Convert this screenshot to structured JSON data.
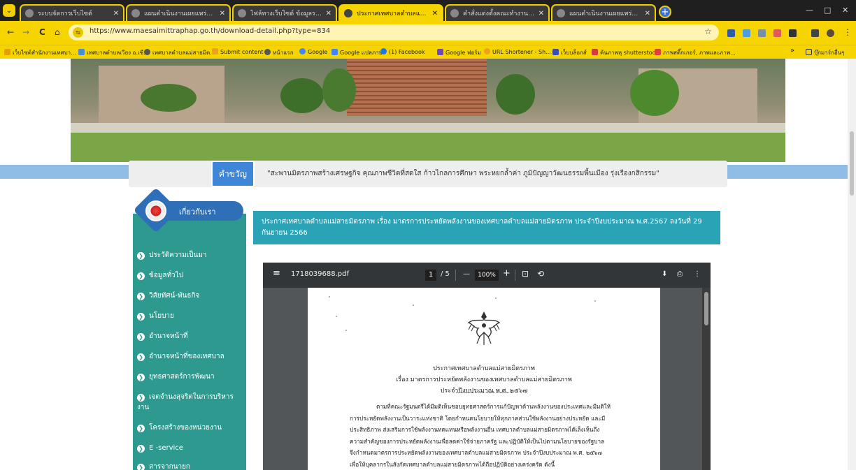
{
  "browser": {
    "tabs": [
      {
        "title": "ระบบจัดการเว็บไซต์",
        "active": false
      },
      {
        "title": "แผนดำเนินงานเผยแพร่ภาพข่าวภารกิจ",
        "active": false
      },
      {
        "title": "ไฟล์ทางเว็บไซต์ ข้อมูลรายเว็บไซต์",
        "active": false
      },
      {
        "title": "ประกาศเทศบาลตำบลแม่สายมิตรภาพ",
        "active": true
      },
      {
        "title": "คำสั่งแต่งตั้งคณะทำงานตามมาตรการ",
        "active": false
      },
      {
        "title": "แผนดำเนินงานเผยแพร่ภาพข่าวภารกิจ",
        "active": false
      }
    ],
    "new_tab_symbol": "+",
    "window_minimize": "—",
    "window_restore": "□",
    "window_close": "✕",
    "nav": {
      "back": "←",
      "forward": "→",
      "reload": "C",
      "home": "⌂"
    },
    "url": "https://www.maesaimittraphap.go.th/download-detail.php?type=834",
    "bookmark_star": "☆",
    "bookmarks": [
      "เว็บไซต์สำนักงานเทศบา...",
      "เทศบาลตำบลเวียง อ.เชี...",
      "เทศบาลตำบลแม่สายมิต...",
      "Submit content",
      "หน้าแรก",
      "Google",
      "Google แปลภาษา",
      "(1) Facebook",
      "Google ฟอร์ม",
      "URL Shortener - Sh...",
      "เว็บบล็อกส์",
      "ค้นภาพหุ shutterstock",
      "ภาพสติ๊กเกอร์, ภาพและภาพ..."
    ],
    "bookmarks_more": "»",
    "other_bookmarks": "บุ๊กมาร์กอื่นๆ"
  },
  "header": {
    "motto_label": "คำขวัญ",
    "motto_text": "\"สะพานมิตรภาพสร้างเศรษฐกิจ คุณภาพชีวิตที่สดใส ก้าวไกลการศึกษา พระหยกล้ำค่า ภูมิปัญญาวัฒนธรรมพื้นเมือง รุ่งเรืองกสิกรรม\""
  },
  "sidebar": {
    "heading": "เกี่ยวกับเรา",
    "items": [
      {
        "label": "ประวัติความเป็นมา"
      },
      {
        "label": "ข้อมูลทั่วไป"
      },
      {
        "label": "วิสัยทัศน์-พันธกิจ"
      },
      {
        "label": "นโยบาย"
      },
      {
        "label": "อำนาจหน้าที่"
      },
      {
        "label": "อำนาจหน้าที่ของเทศบาล"
      },
      {
        "label": "ยุทธศาสตร์การพัฒนา"
      },
      {
        "label": "เจตจำนงสุจริตในการบริหารงาน"
      },
      {
        "label": "โครงสร้างของหน่วยงาน"
      },
      {
        "label": "E -service"
      },
      {
        "label": "สารจากนายก"
      }
    ]
  },
  "content": {
    "title": "ประกาศเทศบาลตำบลแม่สายมิตรภาพ เรื่อง มาตรการประหยัดพลังงานของเทศบาลตำบลแม่สายมิตรภาพ ประจำปีงบประมาณ พ.ศ.2567 ลงวันที่ 29 กันยายน 2566"
  },
  "pdf": {
    "filename": "1718039688.pdf",
    "current_page": "1",
    "total_pages": "/ 5",
    "zoom": "100%",
    "zoom_out": "—",
    "zoom_in": "+",
    "menu_icon": "≡",
    "fit_icon": "⊡",
    "rotate_icon": "⟲",
    "download_icon": "⬇",
    "print_icon": "⎙",
    "more_icon": "⋮",
    "document": {
      "heading": "ประกาศเทศบาลตำบลแม่สายมิตรภาพ",
      "subject": "เรื่อง  มาตรการประหยัดพลังงานของเทศบาลตำบลแม่สายมิตรภาพ",
      "fiscal_year": "ประจำปีงบประมาณ พ.ศ. ๒๕๖๗",
      "body": [
        "ตามที่คณะรัฐมนตรีได้มีมติเห็นชอบยุทธศาสตร์การแก้ปัญหาด้านพลังงานของประเทศและมีมติให้",
        "การประหยัดพลังงานเป็นวาระแห่งชาติ โดยกำหนดนโยบายให้ทุกภาคส่วนใช้พลังงานอย่างประหยัด และมี",
        "ประสิทธิภาพ ส่งเสริมการใช้พลังงานทดแทนหรือพลังงานอื่น เทศบาลตำบลแม่สายมิตรภาพได้เล็งเห็นถึง",
        "ความสำคัญของการประหยัดพลังงานเพื่อลดค่าใช้จ่ายภาครัฐ และปฏิบัติให้เป็นไปตามนโยบายของรัฐบาล",
        "จึงกำหนดมาตรการประหยัดพลังงานของเทศบาลตำบลแม่สายมิตรภาพ ประจำปีงบประมาณ พ.ศ. ๒๕๖๗",
        "เพื่อให้บุคลากรในสังกัดเทศบาลตำบลแม่สายมิตรภาพได้ถือปฏิบัติอย่างเคร่งครัด ดังนี้"
      ]
    }
  },
  "colors": {
    "chrome_yellow": "#f5d400",
    "sidebar_teal": "#2e9a8f",
    "content_header": "#2aa3b7",
    "motto_blue": "#3f86d8",
    "band_blue": "#8fbde6"
  }
}
